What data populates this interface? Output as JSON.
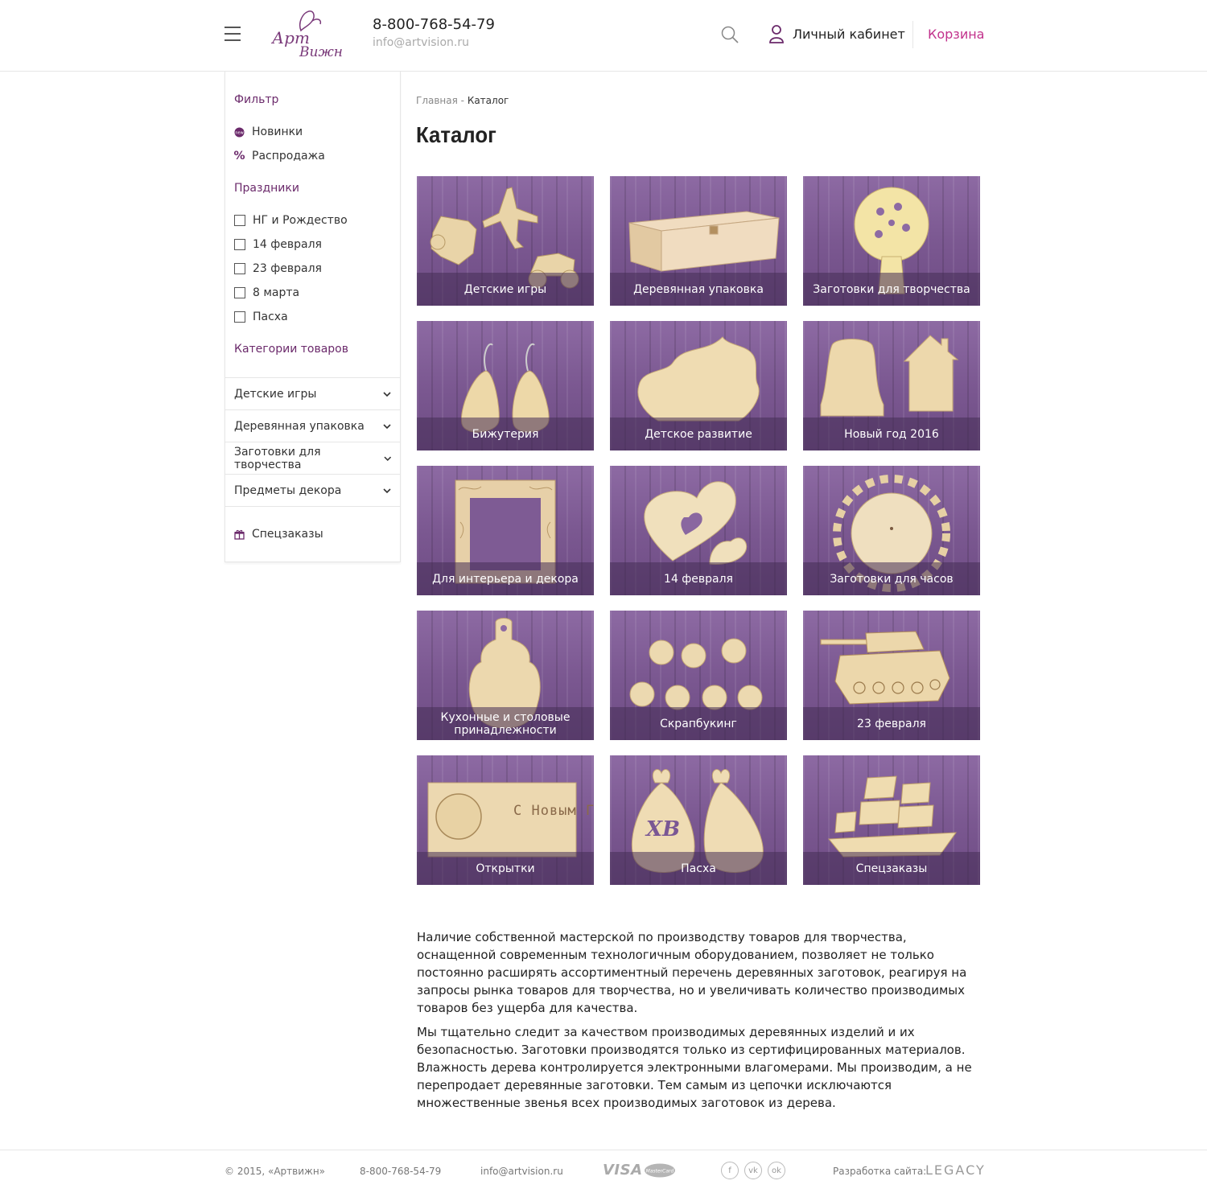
{
  "header": {
    "logo_line1": "Арт",
    "logo_line2": "Вижн",
    "phone": "8-800-768-54-79",
    "email": "info@artvision.ru",
    "account_label": "Личный кабинет",
    "cart_label": "Корзина"
  },
  "sidebar": {
    "filter_heading": "Фильтр",
    "filter_items": [
      "Новинки",
      "Распродажа"
    ],
    "holidays_heading": "Праздники",
    "holidays": [
      "НГ и Рождество",
      "14 февраля",
      "23 февраля",
      "8 марта",
      "Пасха"
    ],
    "categories_heading": "Категории товаров",
    "categories": [
      "Детские игры",
      "Деревянная упаковка",
      "Заготовки для творчества",
      "Предметы декора"
    ],
    "special_orders": "Спецзаказы"
  },
  "breadcrumb": {
    "home": "Главная",
    "separator": " - ",
    "current": "Каталог"
  },
  "page_title": "Каталог",
  "tiles": [
    {
      "label": "Детские игры",
      "icon": "toys-icon"
    },
    {
      "label": "Деревянная упаковка",
      "icon": "box-icon"
    },
    {
      "label": "Заготовки для творчества",
      "icon": "tree-icon"
    },
    {
      "label": "Бижутерия",
      "icon": "earrings-icon"
    },
    {
      "label": "Детское развитие",
      "icon": "hedgehog-icon"
    },
    {
      "label": "Новый год 2016",
      "icon": "bell-house-icon"
    },
    {
      "label": "Для интерьера и декора",
      "icon": "frame-icon"
    },
    {
      "label": "14 февраля",
      "icon": "heart-icon"
    },
    {
      "label": "Заготовки для часов",
      "icon": "clock-icon"
    },
    {
      "label": "Кухонные и столовые принадлежности",
      "icon": "board-icon"
    },
    {
      "label": "Скрапбукинг",
      "icon": "apples-icon"
    },
    {
      "label": "23 февраля",
      "icon": "tank-icon"
    },
    {
      "label": "Открытки",
      "icon": "card-icon"
    },
    {
      "label": "Пасха",
      "icon": "eggs-icon"
    },
    {
      "label": "Спецзаказы",
      "icon": "ship-icon"
    }
  ],
  "card_text": "С Новым Годом !",
  "egg_text": "ХВ",
  "description": [
    "Наличие собственной мастерской по производству товаров для творчества, оснащенной современным технологичным оборудованием, позволяет не только постоянно расширять ассортиментный перечень деревянных заготовок, реагируя на запросы рынка товаров для творчества, но и увеличивать количество производимых товаров без ущерба для качества.",
    "Мы тщательно следит за качеством производимых деревянных изделий и их безопасностью. Заготовки производятся только из сертифицированных материалов. Влажность дерева контролируется электронными влагомерами. Мы производим, а не перепродает деревянные заготовки. Тем самым из цепочки исключаются множественные звенья всех производимых заготовок из дерева."
  ],
  "footer": {
    "copyright": "© 2015, «Артвижн»",
    "phone": "8-800-768-54-79",
    "email": "info@artvision.ru",
    "visa": "VISA",
    "mastercard": "MasterCard",
    "social": [
      "f",
      "vk",
      "ok"
    ],
    "dev_label": "Разработка сайта:",
    "dev_name": "LEGACY"
  },
  "colors": {
    "accent": "#c2328c",
    "heading_purple": "#6b2a6b",
    "wood": "#e9d4a8"
  }
}
